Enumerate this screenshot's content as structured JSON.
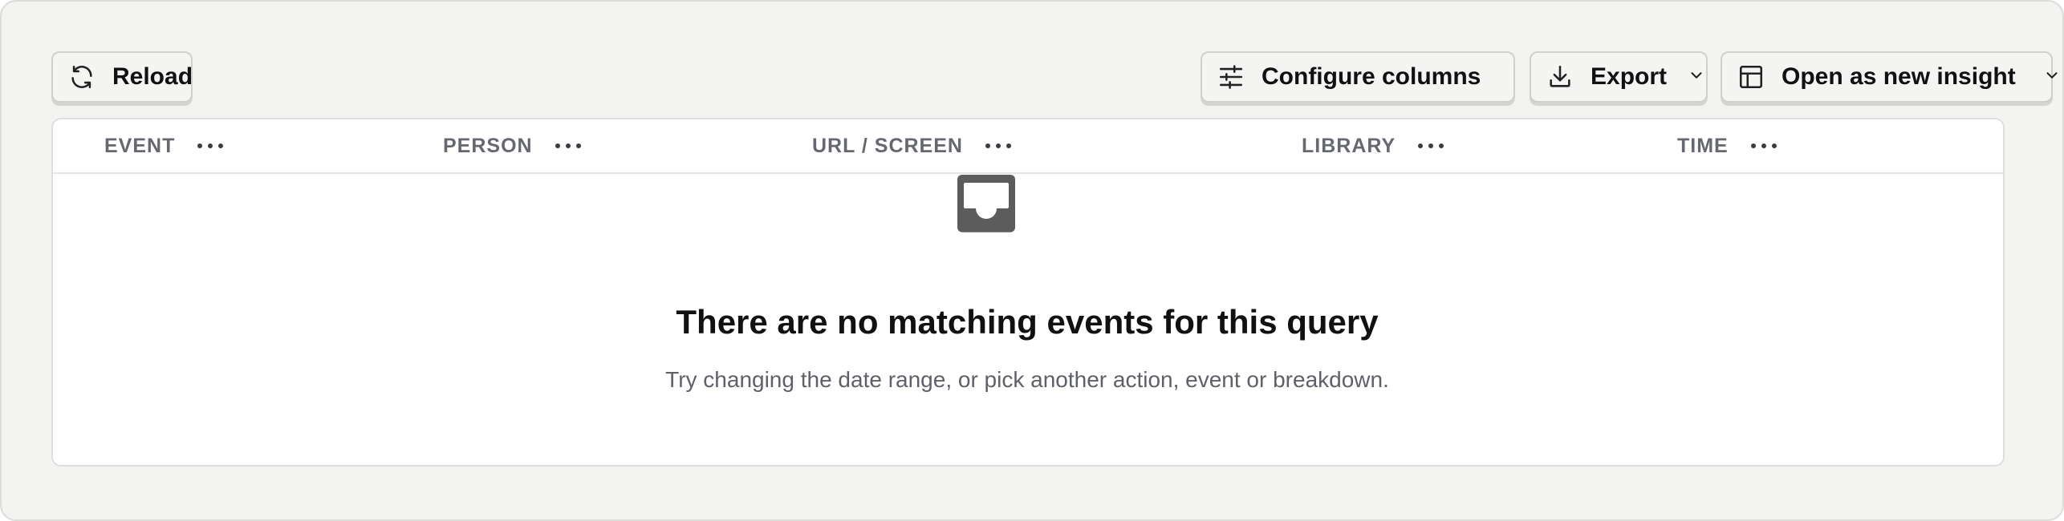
{
  "toolbar": {
    "reload_label": "Reload",
    "reload_icon": "refresh-icon",
    "configure_label": "Configure columns",
    "configure_icon": "sliders-icon",
    "export_label": "Export",
    "export_icon": "download-icon",
    "insight_label": "Open as new insight",
    "insight_icon": "table-layout-icon"
  },
  "table": {
    "columns": [
      {
        "label": "EVENT"
      },
      {
        "label": "PERSON"
      },
      {
        "label": "URL / SCREEN"
      },
      {
        "label": "LIBRARY"
      },
      {
        "label": "TIME"
      }
    ]
  },
  "empty_state": {
    "icon": "inbox-icon",
    "title": "There are no matching events for this query",
    "description": "Try changing the date range, or pick another action, event or breakdown."
  },
  "colors": {
    "background": "#f3f3f1",
    "panel": "#ffffff",
    "header_text": "#66686f",
    "icon": "#5a5a5a"
  }
}
